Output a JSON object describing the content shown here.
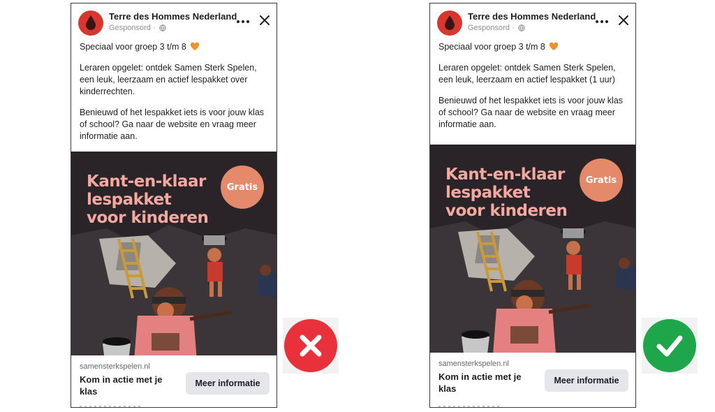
{
  "colors": {
    "avatar_red": "#d8372f",
    "headline_pink": "#f3a9a0",
    "badge_orange": "#e48a6a",
    "image_dark": "#2a2429",
    "wrong_red": "#e8313a",
    "right_green": "#1fa64a",
    "button_gray": "#e4e6eb"
  },
  "cards": {
    "left": {
      "page_name": "Terre des Hommes Nederland",
      "sponsored_label": "Gesponsord ·",
      "intro": "Speciaal voor groep 3 t/m 8",
      "paragraph_1": "Leraren opgelet: ontdek Samen Sterk Spelen, een leuk, leerzaam en actief lespakket over kinderrechten.",
      "paragraph_2": "Benieuwd of het lespakket iets is voor jouw klas of school? Ga naar de website en vraag meer informatie aan.",
      "image": {
        "headline_1": "Kant-en-klaar",
        "headline_2": "lespakket",
        "headline_3": "voor kinderen",
        "badge": "Gratis"
      },
      "domain": "samensterkspelen.nl",
      "cta_title": "Kom in actie met je klas",
      "cta_button": "Meer informatie",
      "icons": [
        "droplet-logo-icon",
        "globe-icon",
        "orange-heart-icon",
        "more-options-icon",
        "close-icon"
      ]
    },
    "right": {
      "page_name": "Terre des Hommes Nederland",
      "sponsored_label": "Gesponsord ·",
      "intro": "Speciaal voor groep 3 t/m 8",
      "paragraph_1": "Leraren opgelet: ontdek Samen Sterk Spelen, een leuk, leerzaam en actief lespakket (1 uur)",
      "paragraph_2": "Benieuwd of het lespakket iets is voor jouw klas of school? Ga naar de website en vraag meer informatie aan.",
      "image": {
        "headline_1": "Kant-en-klaar",
        "headline_2": "lespakket",
        "headline_3": "voor kinderen",
        "badge": "Gratis"
      },
      "domain": "samensterkspelen.nl",
      "cta_title": "Kom in actie met je klas",
      "cta_button": "Meer informatie",
      "icons": [
        "droplet-logo-icon",
        "globe-icon",
        "orange-heart-icon",
        "more-options-icon",
        "close-icon"
      ]
    }
  },
  "verdicts": {
    "left": "wrong-x-icon",
    "right": "correct-check-icon"
  }
}
